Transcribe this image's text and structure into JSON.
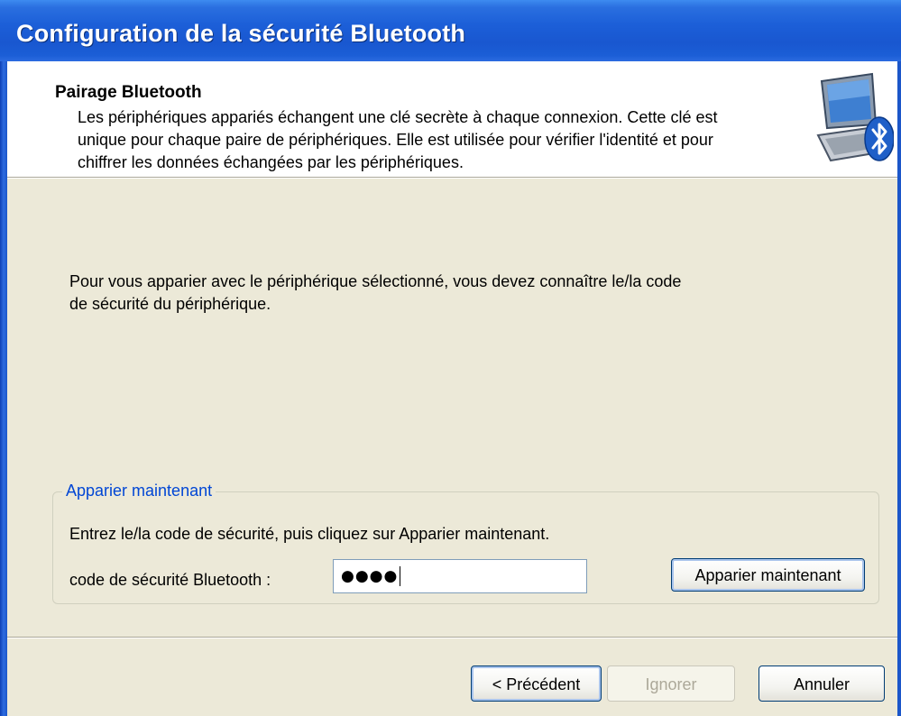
{
  "window": {
    "title": "Configuration de la sécurité Bluetooth"
  },
  "header": {
    "heading": "Pairage Bluetooth",
    "description": "Les périphériques appariés échangent une clé secrète à chaque connexion. Cette clé est unique pour chaque paire de périphériques. Elle est utilisée pour vérifier l'identité et pour chiffrer les données échangées par les périphériques.",
    "icon": "bluetooth-computer-icon"
  },
  "body": {
    "intro": "Pour vous apparier avec le périphérique sélectionné, vous devez connaître le/la code de sécurité du périphérique."
  },
  "pair_group": {
    "legend": "Apparier maintenant",
    "instruction": "Entrez le/la code de sécurité, puis cliquez sur Apparier maintenant.",
    "field_label": "code de sécurité Bluetooth :",
    "field_value": "●●●●",
    "pair_button": "Apparier maintenant"
  },
  "footer": {
    "back_label": "< Précédent",
    "ignore_label": "Ignorer",
    "cancel_label": "Annuler"
  },
  "colors": {
    "titlebar": "#1c5fd8",
    "dialog_bg": "#ece9d8",
    "accent_text": "#0046d5"
  }
}
